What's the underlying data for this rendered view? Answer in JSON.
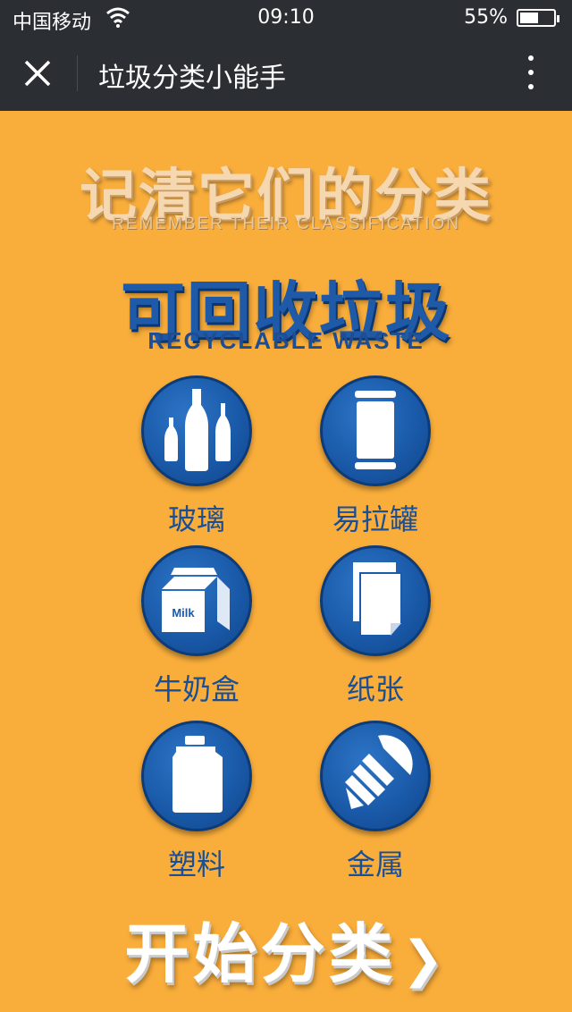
{
  "status_bar": {
    "carrier": "中国移动",
    "time": "09:10",
    "battery_percent": "55%",
    "battery_level": 0.55
  },
  "nav": {
    "title": "垃圾分类小能手",
    "close_icon": "close-icon",
    "more_icon": "more-vertical-icon"
  },
  "headline": {
    "zh": "记清它们的分类",
    "en": "REMEMBER THEIR CLASSIFICATION"
  },
  "category": {
    "zh": "可回收垃圾",
    "en": "RECYCLABLE WASTE"
  },
  "items": [
    {
      "label": "玻璃",
      "icon": "glass-bottles-icon"
    },
    {
      "label": "易拉罐",
      "icon": "can-icon"
    },
    {
      "label": "牛奶盒",
      "icon": "milk-carton-icon",
      "icon_text": "Milk"
    },
    {
      "label": "纸张",
      "icon": "paper-icon"
    },
    {
      "label": "塑料",
      "icon": "plastic-jug-icon"
    },
    {
      "label": "金属",
      "icon": "metal-screw-icon"
    }
  ],
  "start_button": {
    "label": "开始分类",
    "chevron": "❯"
  },
  "colors": {
    "background": "#f9ad3b",
    "bar": "#2b2e33",
    "accent_blue": "#1f5aa8"
  }
}
